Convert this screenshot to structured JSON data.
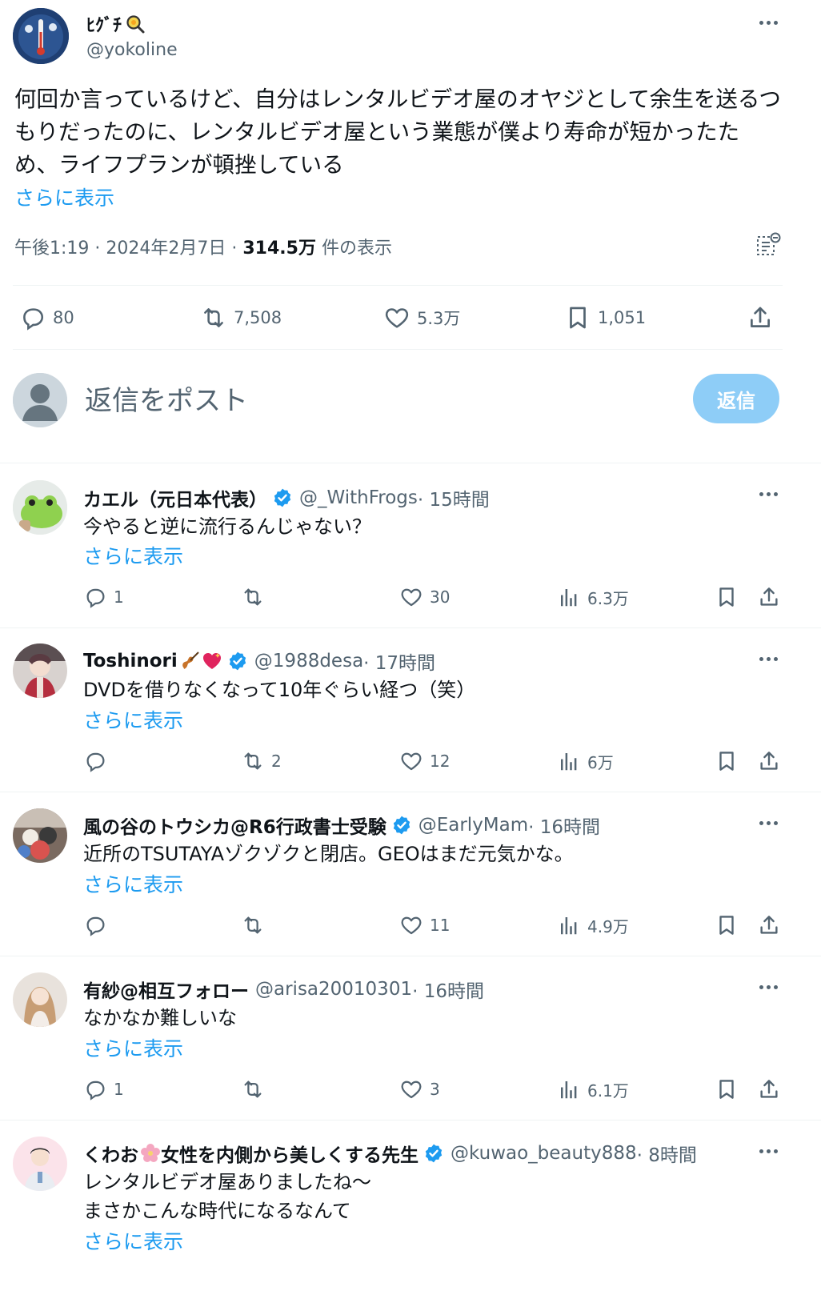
{
  "main_tweet": {
    "author_name": "ﾋｸﾞﾁ",
    "author_handle": "@yokoline",
    "body": "何回か言っているけど、自分はレンタルビデオ屋のオヤジとして余生を送るつもりだったのに、レンタルビデオ屋という業態が僕より寿命が短かったため、ライフプランが頓挫している",
    "show_more": "さらに表示",
    "time": "午後1:19 · 2024年2月7日 · ",
    "views": "314.5万",
    "views_suffix": " 件の表示",
    "replies": "80",
    "reposts": "7,508",
    "likes": "5.3万",
    "bookmarks": "1,051"
  },
  "composer": {
    "placeholder": "返信をポスト",
    "reply_button": "返信"
  },
  "replies": [
    {
      "name": "カエル（元日本代表）",
      "handle": "@_WithFrogs",
      "time": " · 15時間",
      "text": "今やると逆に流行るんじゃない？",
      "show_more": "さらに表示",
      "reply_count": "1",
      "repost_count": "",
      "like_count": "30",
      "views": "6.3万"
    },
    {
      "name": "Toshinori",
      "handle": "@1988desa",
      "time": " · 17時間",
      "text": "DVDを借りなくなって10年ぐらい経つ（笑）",
      "show_more": "さらに表示",
      "reply_count": "",
      "repost_count": "2",
      "like_count": "12",
      "views": "6万"
    },
    {
      "name": "風の谷のトウシカ@R6行政書士受験",
      "handle": "@EarlyMam",
      "time": " · 16時間",
      "text": "近所のTSUTAYAゾクゾクと閉店。GEOはまだ元気かな。",
      "show_more": "さらに表示",
      "reply_count": "",
      "repost_count": "",
      "like_count": "11",
      "views": "4.9万"
    },
    {
      "name": "有紗@相互フォロー",
      "handle": "@arisa20010301",
      "time": " · 16時間",
      "text": "なかなか難しいな",
      "show_more": "さらに表示",
      "reply_count": "1",
      "repost_count": "",
      "like_count": "3",
      "views": "6.1万"
    },
    {
      "name_a": "くわお",
      "name_b": "女性を内側から美しくする先生",
      "handle": "@kuwao_beauty888",
      "time": " · 8時間",
      "text_line1": "レンタルビデオ屋ありましたね～",
      "text_line2": "まさかこんな時代になるなんて",
      "show_more": "さらに表示"
    }
  ],
  "colors": {
    "accent": "#1d9bf0",
    "muted": "#536471",
    "reply_button_bg": "#8ecdf7",
    "divider": "#eff3f4"
  },
  "icons": [
    "comment-icon",
    "repost-icon",
    "heart-icon",
    "bookmark-icon",
    "share-icon",
    "views-icon",
    "verified-icon",
    "more-icon",
    "analytics-icon",
    "magnifier-icon",
    "violin-icon",
    "heart-sparkle-icon",
    "flower-icon"
  ]
}
